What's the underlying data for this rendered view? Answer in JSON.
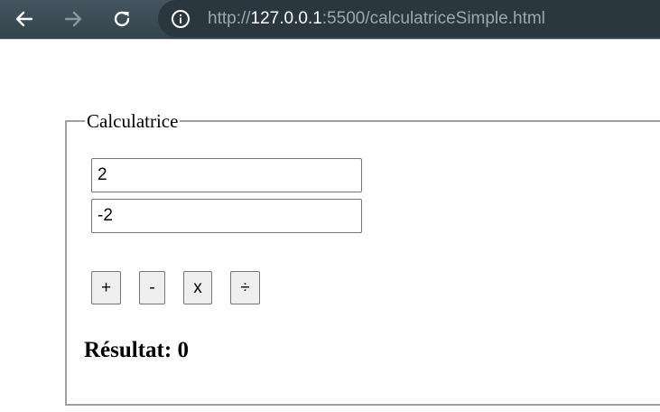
{
  "browser": {
    "url_scheme": "http://",
    "url_host": "127.0.0.1",
    "url_rest": ":5500/calculatriceSimple.html"
  },
  "calculator": {
    "legend": "Calculatrice",
    "input_a": "2",
    "input_b": "-2",
    "buttons": {
      "add": "+",
      "subtract": "-",
      "multiply": "x",
      "divide": "÷"
    },
    "result_label": "Résultat:",
    "result_value": "0"
  },
  "colors": {
    "toolbar": "#3c4f59",
    "omnibox": "#2a373e",
    "button_bg": "#efefef",
    "fieldset_border": "#a0a0a0"
  }
}
